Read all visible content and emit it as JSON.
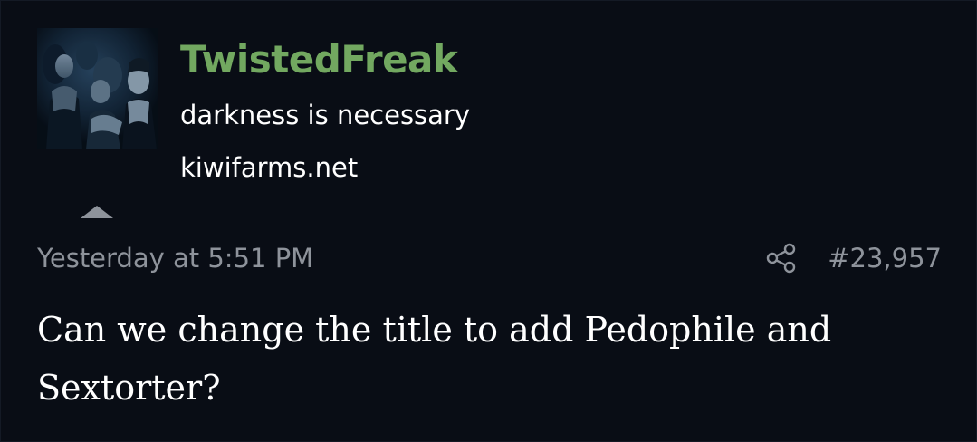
{
  "user": {
    "username": "TwistedFreak",
    "user_title": "darkness is necessary",
    "banner": "kiwifarms.net",
    "avatar_icon": "avatar-photo",
    "username_color": "#72a860"
  },
  "post": {
    "timestamp": "Yesterday at 5:51 PM",
    "post_number": "#23,957",
    "share_icon": "share-icon",
    "collapse_icon": "caret-up-icon",
    "body": "Can we change the title to add Pedophile and Sextorter?"
  },
  "theme": {
    "background": "#090d15",
    "text": "#ffffff",
    "muted": "#8e939b"
  }
}
